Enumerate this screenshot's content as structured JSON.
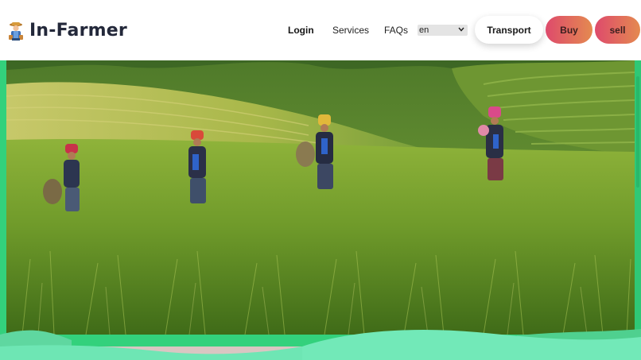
{
  "brand": {
    "name": "In-Farmer",
    "logo_icon": "farmer-icon"
  },
  "nav": {
    "login": "Login",
    "services": "Services",
    "faqs": "FAQs",
    "language": {
      "selected": "en"
    }
  },
  "actions": {
    "transport": "Transport",
    "buy": "Buy",
    "sell": "sell"
  },
  "colors": {
    "frame_green": "#33d17c",
    "wave_green": "#6ee6b4",
    "button_gradient_start": "#de4a6c",
    "button_gradient_end": "#e48a50"
  }
}
